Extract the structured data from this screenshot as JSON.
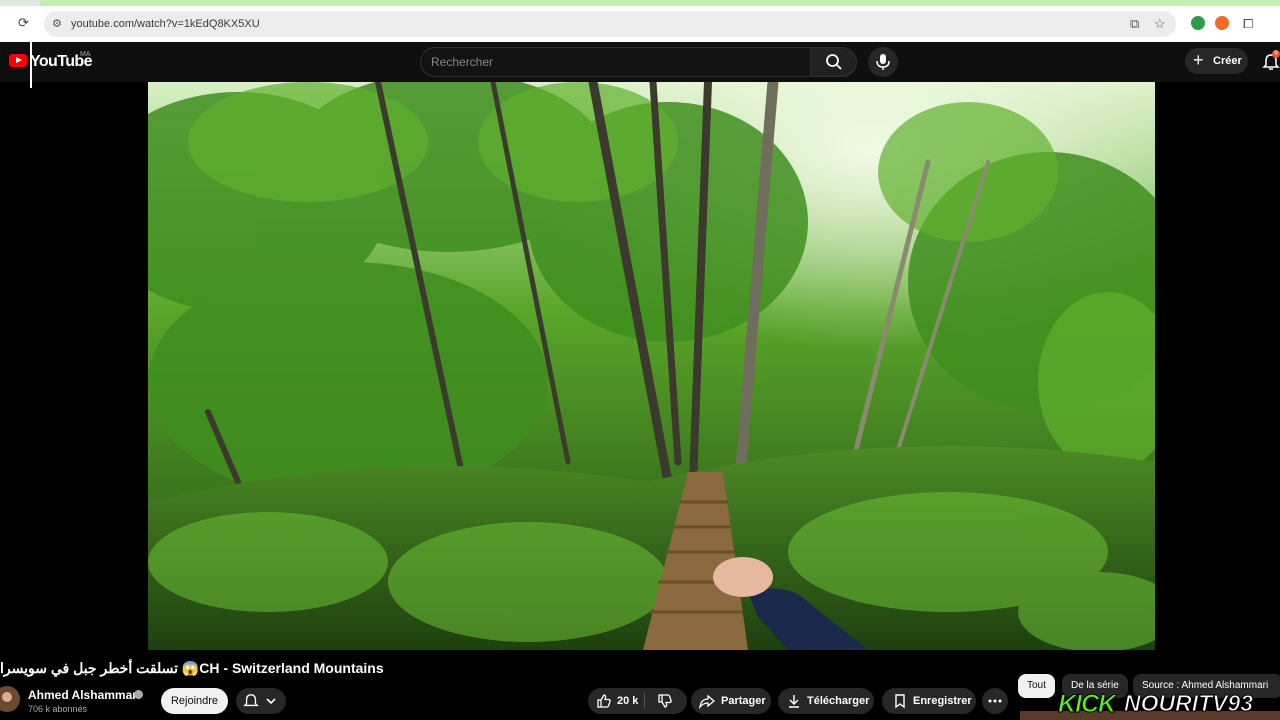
{
  "browser": {
    "url": "youtube.com/watch?v=1kEdQ8KX5XU"
  },
  "header": {
    "logo_text": "YouTube",
    "country_code": "MA",
    "search_placeholder": "Rechercher",
    "create_label": "Créer",
    "notification_count": "9"
  },
  "video": {
    "title": "تسلقت أخطر جبل في سويسرا 😱CH - Switzerland Mountains"
  },
  "channel": {
    "name": "Ahmed Alshammari",
    "subscribers": "706 k abonnés",
    "join_label": "Rejoindre"
  },
  "actions": {
    "like_count": "20 k",
    "share_label": "Partager",
    "download_label": "Télécharger",
    "save_label": "Enregistrer"
  },
  "chips": {
    "all": "Tout",
    "series": "De la série",
    "source": "Source : Ahmed Alshammari"
  },
  "overlay": {
    "kick": "KICK",
    "channel_handle": "NOURITV93"
  },
  "colors": {
    "brand_red": "#ff0000",
    "kick_green": "#53fc18",
    "background": "#0f0f0f"
  }
}
